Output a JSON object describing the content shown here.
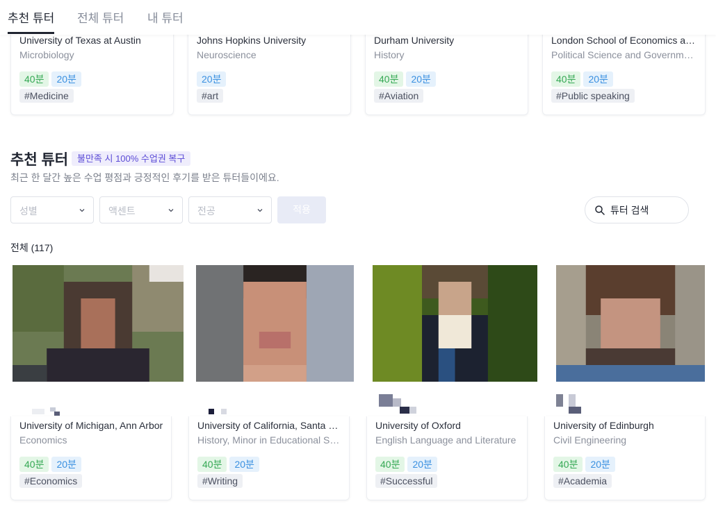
{
  "tabs": [
    {
      "label": "추천 튜터",
      "active": true
    },
    {
      "label": "전체 튜터",
      "active": false
    },
    {
      "label": "내 튜터",
      "active": false
    }
  ],
  "top_cards": [
    {
      "university": "University of Texas at Austin",
      "major": "Microbiology",
      "durations": [
        "40분",
        "20분"
      ],
      "tag": "#Medicine"
    },
    {
      "university": "Johns Hopkins University",
      "major": "Neuroscience",
      "durations": [
        "20분"
      ],
      "tag": "#art"
    },
    {
      "university": "Durham University",
      "major": "History",
      "durations": [
        "40분",
        "20분"
      ],
      "tag": "#Aviation"
    },
    {
      "university": "London School of Economics and Political Science",
      "major": "Political Science and Government",
      "durations": [
        "40분",
        "20분"
      ],
      "tag": "#Public speaking"
    }
  ],
  "section": {
    "title": "추천 튜터",
    "promo": "불만족 시 100% 수업권 복구",
    "subtitle": "최근 한 달간 높은 수업 평점과 긍정적인 후기를 받은 튜터들이에요."
  },
  "filters": {
    "gender": "성별",
    "accent": "액센트",
    "major": "전공",
    "apply": "적용"
  },
  "search": {
    "value": "튜터 검색"
  },
  "count": "전체 (117)",
  "tutors": [
    {
      "university": "University of Michigan, Ann Arbor",
      "major": "Economics",
      "durations": [
        "40분",
        "20분"
      ],
      "tag": "#Economics"
    },
    {
      "university": "University of California, Santa Barbara",
      "major": "History, Minor in Educational Studies",
      "durations": [
        "40분",
        "20분"
      ],
      "tag": "#Writing"
    },
    {
      "university": "University of Oxford",
      "major": "English Language and Literature",
      "durations": [
        "40분",
        "20분"
      ],
      "tag": "#Successful"
    },
    {
      "university": "University of Edinburgh",
      "major": "Civil Engineering",
      "durations": [
        "40분",
        "20분"
      ],
      "tag": "#Academia"
    }
  ],
  "colors": {
    "accent": "#5b4bd6",
    "green_badge": "#34a853",
    "blue_badge": "#3a90e0"
  }
}
